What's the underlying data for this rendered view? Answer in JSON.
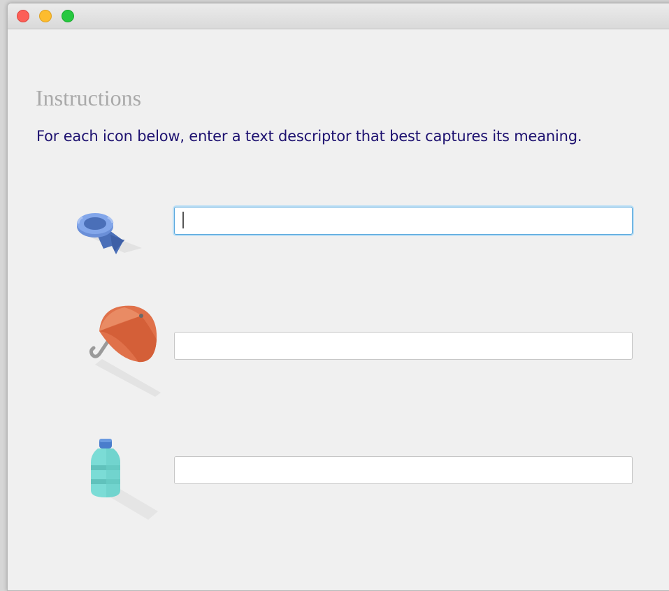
{
  "window": {
    "controls": [
      "close",
      "minimize",
      "zoom"
    ]
  },
  "instructions": {
    "heading": "Instructions",
    "text": "For each icon below, enter a text descriptor that best captures its meaning."
  },
  "items": [
    {
      "icon": "ribbon-badge-icon",
      "value": "",
      "placeholder": ""
    },
    {
      "icon": "umbrella-icon",
      "value": "",
      "placeholder": ""
    },
    {
      "icon": "water-bottle-icon",
      "value": "",
      "placeholder": ""
    }
  ],
  "colors": {
    "heading": "#a9a9a9",
    "instruction_text": "#1e1270",
    "focus_ring": "#59a8dd",
    "ribbon": "#6a8fd8",
    "umbrella": "#e0714a",
    "bottle": "#7bdcd6"
  }
}
